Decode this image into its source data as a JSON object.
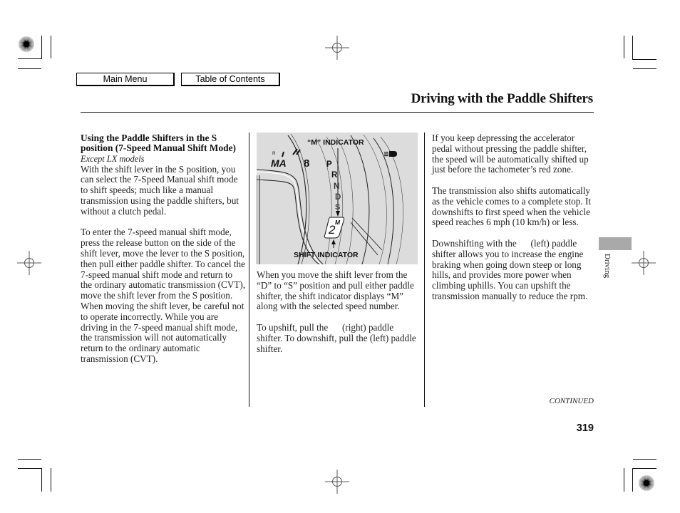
{
  "nav": {
    "main_menu_label": "Main Menu",
    "toc_label": "Table of Contents"
  },
  "header": {
    "title": "Driving with the Paddle Shifters"
  },
  "left_column": {
    "heading": "Using the Paddle Shifters in the S position (7-Speed Manual Shift Mode)",
    "note": "Except LX models",
    "paragraphs": [
      "With the shift lever in the S position, you can select the 7-Speed Manual shift mode to shift speeds; much like a manual transmission using the paddle shifters, but without a clutch pedal.",
      "To enter the 7-speed manual shift mode, press the release button on the side of the shift lever, move the lever to the S position, then pull either paddle shifter. To cancel the 7-speed manual shift mode and return to the ordinary automatic transmission (CVT), move the shift lever from the S position. When moving the shift lever, be careful not to operate incorrectly. While you are driving in the 7-speed manual shift mode, the transmission will not automatically return to the ordinary automatic transmission (CVT)."
    ]
  },
  "figure": {
    "label_top": "“M” INDICATOR",
    "label_bottom": "SHIFT INDICATOR",
    "gauge_text": [
      "n",
      "MA",
      "8"
    ],
    "gear_positions": [
      "P",
      "R",
      "N",
      "D",
      "S"
    ],
    "shift_display_mode": "M",
    "shift_display_gear": "2",
    "icon": "headlight-indicator-icon"
  },
  "middle_column": {
    "paragraphs": [
      "When you move the shift lever from the “D” to “S” position and pull either paddle shifter, the shift indicator displays “M” along with the selected speed number.",
      "To upshift, pull the      (right) paddle shifter. To downshift, pull the (left) paddle shifter."
    ]
  },
  "right_column": {
    "paragraphs": [
      "If you keep depressing the accelerator pedal without pressing the paddle shifter, the speed will be automatically shifted up just before the tachometer’s red zone.",
      "The transmission also shifts automatically as the vehicle comes to a complete stop. It downshifts to first speed when the vehicle speed reaches 6 mph (10 km/h) or less.",
      "Downshifting with the      (left) paddle shifter allows you to increase the engine braking when going down steep or long hills, and provides more power when climbing uphills. You can upshift the transmission manually to reduce the rpm."
    ]
  },
  "footer": {
    "continued": "CONTINUED",
    "page_number": "319",
    "section_tab": "Driving"
  },
  "colors": {
    "figure_bg": "#dcdcdc",
    "section_tab": "#a9a9a9"
  }
}
